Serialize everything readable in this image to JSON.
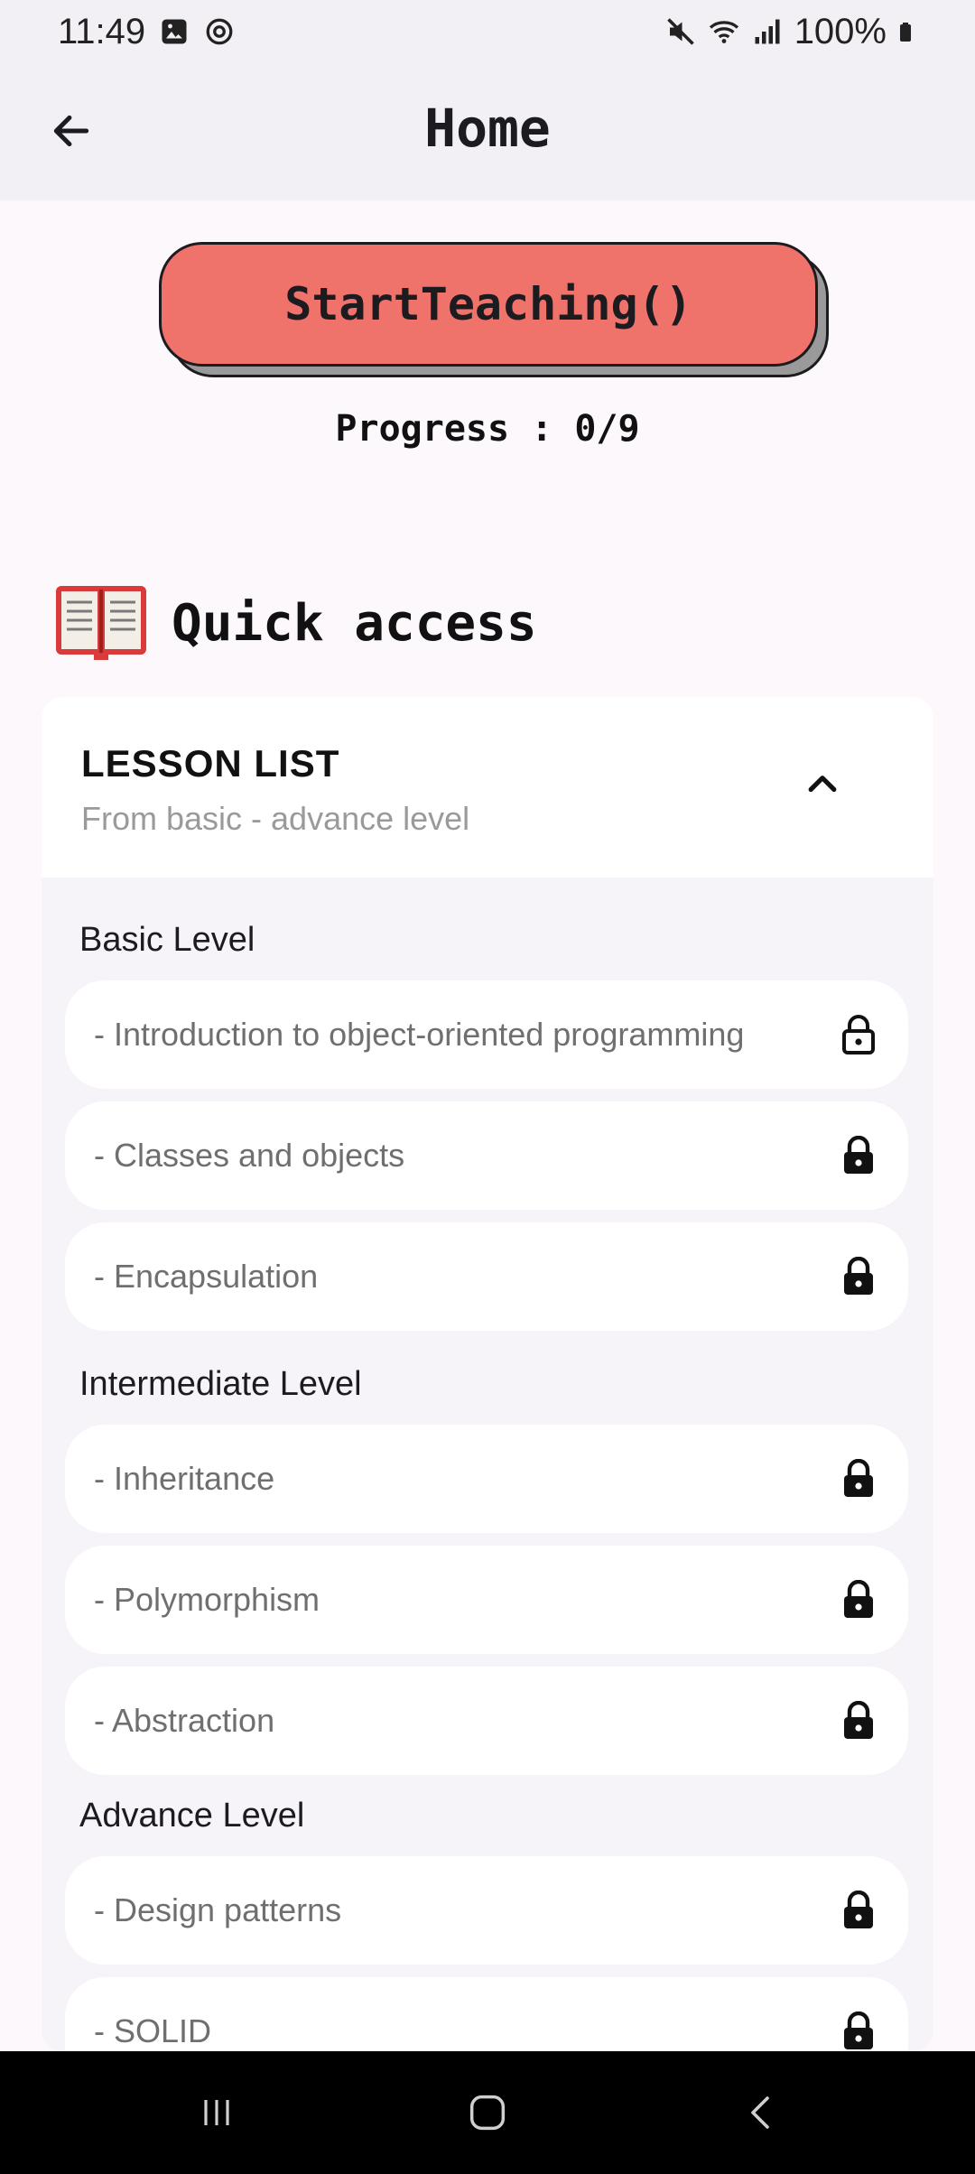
{
  "status_bar": {
    "time": "11:49",
    "battery": "100%",
    "icons": [
      "image-icon",
      "sync-icon",
      "mute-icon",
      "wifi-icon",
      "signal-icon",
      "battery-icon"
    ]
  },
  "app_bar": {
    "title": "Home",
    "back_icon": "arrow-left-icon"
  },
  "start_button": {
    "label": "StartTeaching()",
    "color": "#ef736b"
  },
  "progress": {
    "text": "Progress : 0/9",
    "completed": 0,
    "total": 9
  },
  "quick_access": {
    "icon": "open-book-icon",
    "title": "Quick access"
  },
  "lesson_list": {
    "title": "LESSON LIST",
    "subtitle": "From basic - advance level",
    "expanded": true,
    "levels": [
      {
        "label": "Basic Level",
        "lessons": [
          {
            "label": "- Introduction to object-oriented programming",
            "lock": "unlocked"
          },
          {
            "label": "- Classes and objects",
            "lock": "locked"
          },
          {
            "label": "- Encapsulation",
            "lock": "locked"
          }
        ]
      },
      {
        "label": "Intermediate Level",
        "lessons": [
          {
            "label": "- Inheritance",
            "lock": "locked"
          },
          {
            "label": "- Polymorphism",
            "lock": "locked"
          },
          {
            "label": "- Abstraction",
            "lock": "locked"
          }
        ]
      },
      {
        "label": "Advance Level",
        "lessons": [
          {
            "label": "- Design patterns",
            "lock": "locked"
          },
          {
            "label": "- SOLID",
            "lock": "locked"
          }
        ]
      }
    ]
  },
  "nav_bar": {
    "icons": [
      "recents-icon",
      "home-icon",
      "back-icon"
    ]
  }
}
